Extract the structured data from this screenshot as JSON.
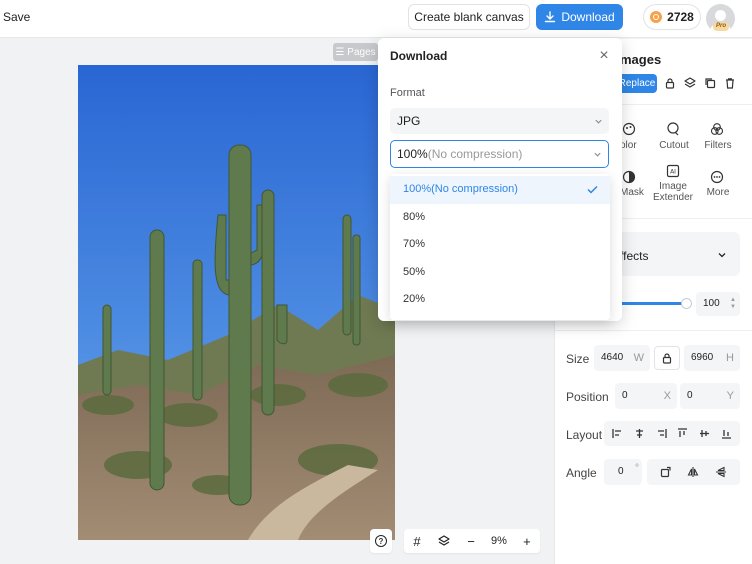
{
  "topbar": {
    "save_label": "Save",
    "blank_canvas_label": "Create blank canvas",
    "download_label": "Download",
    "coins": "2728",
    "pro_badge": "Pro"
  },
  "canvas": {
    "pages_label": "Pages",
    "zoom": "9%"
  },
  "panel": {
    "title": "mages",
    "replace_label": "Replace",
    "tools": [
      "olor",
      "Cutout",
      "Filters",
      "Mask",
      "Image Extender",
      "More"
    ],
    "effects_label": "ffects",
    "opacity": "100",
    "size_label": "Size",
    "width": "4640",
    "width_unit": "W",
    "height": "6960",
    "height_unit": "H",
    "position_label": "Position",
    "pos_x": "0",
    "pos_x_unit": "X",
    "pos_y": "0",
    "pos_y_unit": "Y",
    "layout_label": "Layout",
    "angle_label": "Angle",
    "angle": "0",
    "angle_unit": "°"
  },
  "modal": {
    "title": "Download",
    "format_label": "Format",
    "format_value": "JPG",
    "quality_value_main": "100%",
    "quality_value_note": "(No compression)",
    "options": [
      "100%(No compression)",
      "80%",
      "70%",
      "50%",
      "20%"
    ],
    "selected_index": 0
  },
  "colors": {
    "accent": "#2f86e6",
    "sky": "#2f6fd6",
    "coin": "#f7a14a"
  }
}
